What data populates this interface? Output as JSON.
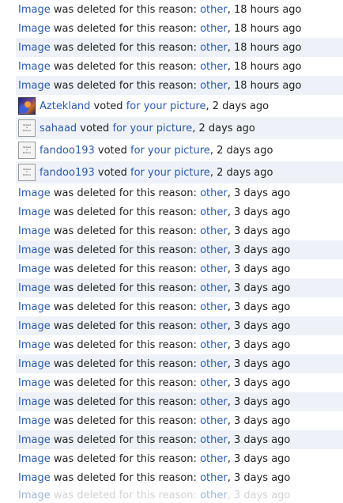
{
  "text": {
    "image": "Image",
    "deleted_reason": " was deleted for this reason: ",
    "other": "other",
    "voted": " voted ",
    "for_your_picture": "for your picture",
    "upload_placeholder": [
      "Upload",
      "a",
      "Picture"
    ],
    "comma_sep": ", "
  },
  "feed": [
    {
      "type": "deleted",
      "time": "18 hours ago",
      "alt": false
    },
    {
      "type": "deleted",
      "time": "18 hours ago",
      "alt": false
    },
    {
      "type": "deleted",
      "time": "18 hours ago",
      "alt": true
    },
    {
      "type": "deleted",
      "time": "18 hours ago",
      "alt": false
    },
    {
      "type": "deleted",
      "time": "18 hours ago",
      "alt": true
    },
    {
      "type": "vote",
      "user": "Aztekland",
      "avatar": "photo",
      "time": "2 days ago",
      "alt": false
    },
    {
      "type": "vote",
      "user": "sahaad",
      "avatar": "placeholder",
      "time": "2 days ago",
      "alt": true
    },
    {
      "type": "vote",
      "user": "fandoo193",
      "avatar": "placeholder",
      "time": "2 days ago",
      "alt": false
    },
    {
      "type": "vote",
      "user": "fandoo193",
      "avatar": "placeholder",
      "time": "2 days ago",
      "alt": true
    },
    {
      "type": "deleted",
      "time": "3 days ago",
      "alt": false
    },
    {
      "type": "deleted",
      "time": "3 days ago",
      "alt": false
    },
    {
      "type": "deleted",
      "time": "3 days ago",
      "alt": false
    },
    {
      "type": "deleted",
      "time": "3 days ago",
      "alt": true
    },
    {
      "type": "deleted",
      "time": "3 days ago",
      "alt": false
    },
    {
      "type": "deleted",
      "time": "3 days ago",
      "alt": true
    },
    {
      "type": "deleted",
      "time": "3 days ago",
      "alt": false
    },
    {
      "type": "deleted",
      "time": "3 days ago",
      "alt": true
    },
    {
      "type": "deleted",
      "time": "3 days ago",
      "alt": false
    },
    {
      "type": "deleted",
      "time": "3 days ago",
      "alt": true
    },
    {
      "type": "deleted",
      "time": "3 days ago",
      "alt": false
    },
    {
      "type": "deleted",
      "time": "3 days ago",
      "alt": true
    },
    {
      "type": "deleted",
      "time": "3 days ago",
      "alt": false
    },
    {
      "type": "deleted",
      "time": "3 days ago",
      "alt": true
    },
    {
      "type": "deleted",
      "time": "3 days ago",
      "alt": false
    },
    {
      "type": "deleted",
      "time": "3 days ago",
      "alt": false
    },
    {
      "type": "deleted",
      "time": "3 days ago",
      "alt": false,
      "cut": true
    }
  ]
}
